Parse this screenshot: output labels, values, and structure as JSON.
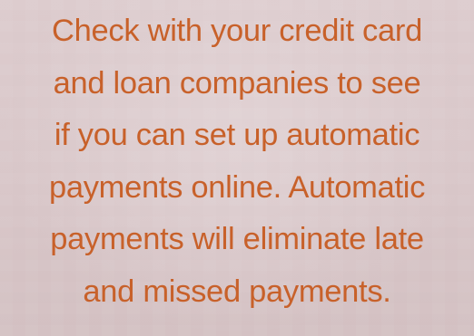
{
  "tip": {
    "lines": [
      "Check with your credit card",
      "and loan companies to see",
      "if you can set up automatic",
      "payments online. Automatic",
      "payments will eliminate late",
      "and missed payments."
    ]
  },
  "colors": {
    "background": "#d9c8ca",
    "text": "#c8612a"
  }
}
